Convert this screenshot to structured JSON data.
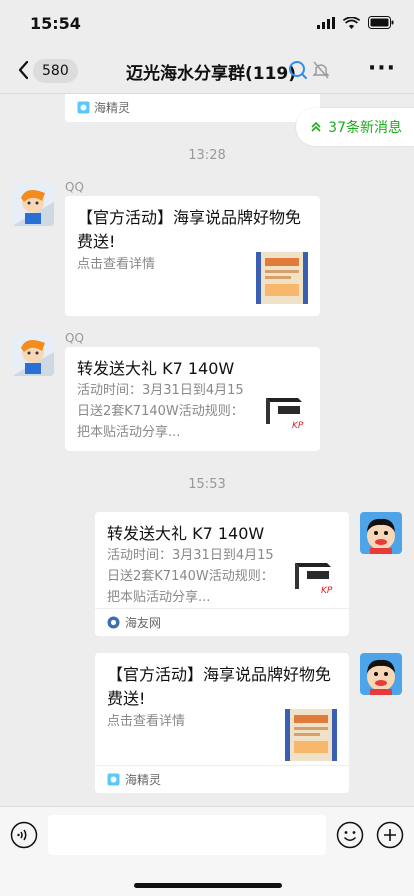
{
  "status_bar": {
    "time": "15:54"
  },
  "nav": {
    "back_count": "580",
    "title": "迈光海水分享群(119)"
  },
  "new_messages": "37条新消息",
  "messages": [
    {
      "kind": "card-tail",
      "source": "海精灵"
    },
    {
      "kind": "timestamp",
      "text": "13:28"
    },
    {
      "kind": "card",
      "side": "left",
      "sender": "QQ",
      "title": "【官方活动】海享说品牌好物免费送!",
      "desc": "点击查看详情"
    },
    {
      "kind": "card",
      "side": "left",
      "sender": "QQ",
      "title": "转发送大礼 K7 140W",
      "desc": "活动时间：3月31日到4月15日送2套K7140W活动规则：把本贴活动分享..."
    },
    {
      "kind": "timestamp",
      "text": "15:53"
    },
    {
      "kind": "card",
      "side": "right",
      "title": "转发送大礼 K7 140W",
      "desc": "活动时间：3月31日到4月15日送2套K7140W活动规则：把本贴活动分享...",
      "source": "海友网"
    },
    {
      "kind": "card",
      "side": "right",
      "title": "【官方活动】海享说品牌好物免费送!",
      "desc": "点击查看详情",
      "source": "海精灵"
    }
  ],
  "colors": {
    "background": "#ededed",
    "accent": "#1aad19",
    "card": "#ffffff"
  }
}
